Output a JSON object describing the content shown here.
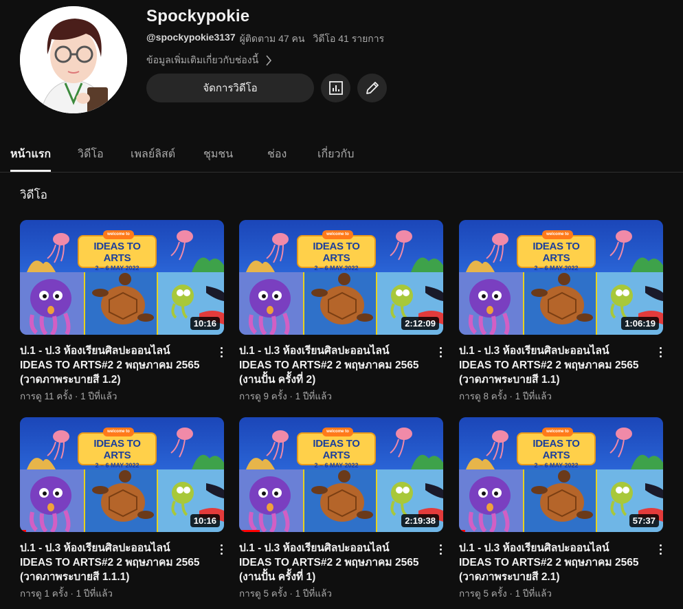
{
  "channel": {
    "name": "Spockypokie",
    "handle": "@spockypokie3137",
    "subscribers": "ผู้ติดตาม 47 คน",
    "videos_count": "วิดีโอ 41 รายการ",
    "more_info": "ข้อมูลเพิ่มเติมเกี่ยวกับช่องนี้",
    "manage_videos_label": "จัดการวิดีโอ",
    "icons": [
      "chevron-right-icon",
      "analytics-icon",
      "edit-pencil-icon"
    ]
  },
  "tabs": [
    {
      "label": "หน้าแรก",
      "active": true
    },
    {
      "label": "วิดีโอ",
      "active": false
    },
    {
      "label": "เพลย์ลิสต์",
      "active": false
    },
    {
      "label": "ชุมชน",
      "active": false
    },
    {
      "label": "ช่อง",
      "active": false
    },
    {
      "label": "เกี่ยวกับ",
      "active": false
    }
  ],
  "section": {
    "title": "วิดีโอ"
  },
  "thumbnail_text": {
    "welcome": "welcome to",
    "title": "IDEAS TO ARTS",
    "dates": "2 – 6 MAY 2022"
  },
  "videos": [
    {
      "title": "ป.1 - ป.3 ห้องเรียนศิลปะออนไลน์ IDEAS TO ARTS#2  2 พฤษภาคม 2565 (วาดภาพระบายสี 1.2)",
      "stats": "การดู 11 ครั้ง · 1 ปีที่แล้ว",
      "duration": "10:16",
      "watched": 0
    },
    {
      "title": "ป.1 - ป.3 ห้องเรียนศิลปะออนไลน์ IDEAS TO ARTS#2  2 พฤษภาคม 2565 (งานปั้น ครั้งที่ 2)",
      "stats": "การดู 9 ครั้ง · 1 ปีที่แล้ว",
      "duration": "2:12:09",
      "watched": 0
    },
    {
      "title": "ป.1 - ป.3 ห้องเรียนศิลปะออนไลน์ IDEAS TO ARTS#2  2 พฤษภาคม 2565 (วาดภาพระบายสี 1.1)",
      "stats": "การดู 8 ครั้ง · 1 ปีที่แล้ว",
      "duration": "1:06:19",
      "watched": 0
    },
    {
      "title": "ป.1 - ป.3 ห้องเรียนศิลปะออนไลน์ IDEAS TO ARTS#2  2 พฤษภาคม 2565 (วาดภาพระบายสี 1.1.1)",
      "stats": "การดู 1 ครั้ง · 1 ปีที่แล้ว",
      "duration": "10:16",
      "watched": 0.03
    },
    {
      "title": "ป.1 - ป.3 ห้องเรียนศิลปะออนไลน์ IDEAS TO ARTS#2  2 พฤษภาคม 2565 (งานปั้น ครั้งที่ 1)",
      "stats": "การดู 5 ครั้ง · 1 ปีที่แล้ว",
      "duration": "2:19:38",
      "watched": 0.1
    },
    {
      "title": "ป.1 - ป.3 ห้องเรียนศิลปะออนไลน์ IDEAS TO ARTS#2  2 พฤษภาคม 2565 (วาดภาพระบายสี 2.1)",
      "stats": "การดู 5 ครั้ง · 1 ปีที่แล้ว",
      "duration": "57:37",
      "watched": 0.03
    }
  ],
  "colors": {
    "background": "#0f0f0f",
    "button": "#272727",
    "progress": "#ff0000",
    "secondary_text": "#aaaaaa"
  }
}
